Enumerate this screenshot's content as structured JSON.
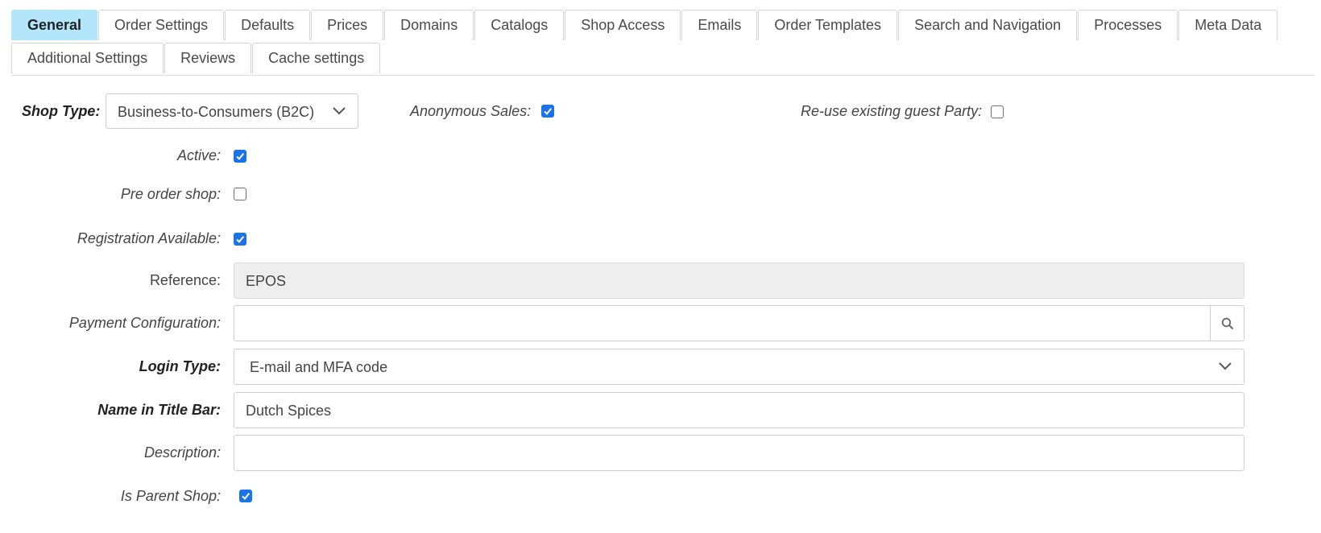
{
  "tabs": {
    "row1": [
      "General",
      "Order Settings",
      "Defaults",
      "Prices",
      "Domains",
      "Catalogs",
      "Shop Access",
      "Emails",
      "Order Templates",
      "Search and Navigation",
      "Processes",
      "Meta Data"
    ],
    "row2": [
      "Additional Settings",
      "Reviews",
      "Cache settings"
    ],
    "active": "General"
  },
  "form": {
    "shop_type": {
      "label": "Shop Type:",
      "value": "Business-to-Consumers (B2C)"
    },
    "anonymous_sales": {
      "label": "Anonymous Sales:",
      "checked": true
    },
    "reuse_guest_party": {
      "label": "Re-use existing guest Party:",
      "checked": false
    },
    "active": {
      "label": "Active:",
      "checked": true
    },
    "pre_order_shop": {
      "label": "Pre order shop:",
      "checked": false
    },
    "registration_available": {
      "label": "Registration Available:",
      "checked": true
    },
    "reference": {
      "label": "Reference:",
      "value": "EPOS"
    },
    "payment_configuration": {
      "label": "Payment Configuration:",
      "value": ""
    },
    "login_type": {
      "label": "Login Type:",
      "value": "E-mail and MFA code"
    },
    "name_in_title_bar": {
      "label": "Name in Title Bar:",
      "value": "Dutch Spices"
    },
    "description": {
      "label": "Description:",
      "value": ""
    },
    "is_parent_shop": {
      "label": "Is Parent Shop:",
      "checked": true
    }
  },
  "colors": {
    "active_tab": "#b3e5fb",
    "checkbox_checked": "#1a73e8",
    "readonly_field": "#eeeeee"
  },
  "icons": {
    "dropdown": "chevron-down-icon",
    "lookup": "search-icon",
    "check": "checkmark-icon"
  }
}
